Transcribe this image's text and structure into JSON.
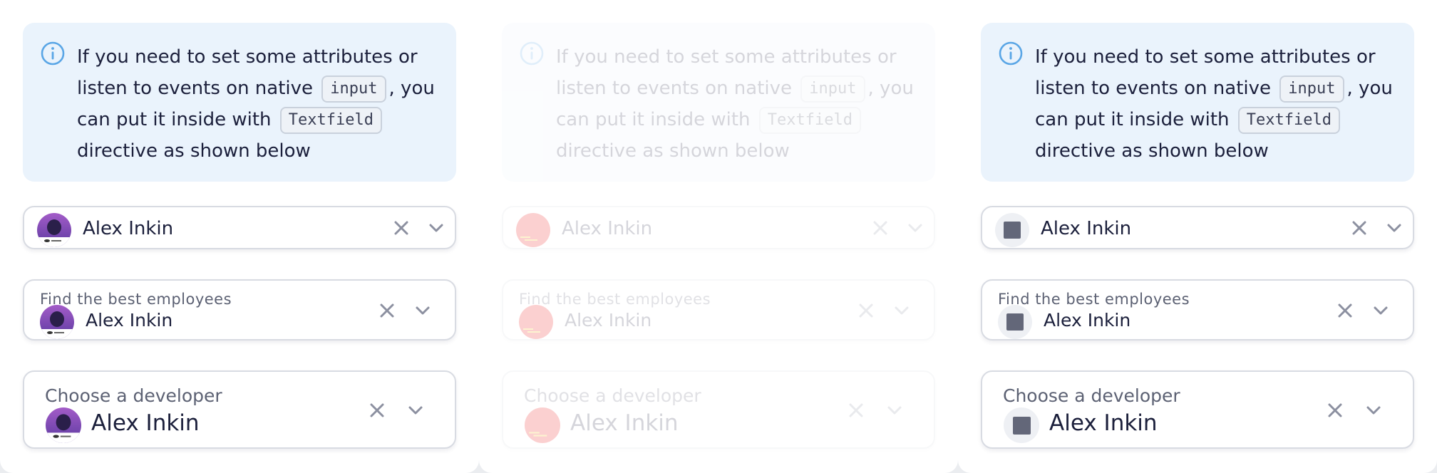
{
  "notice": {
    "text_before_input": "If you need to set some attributes or listen to events on native",
    "input_code": "input",
    "text_middle": ", you can put it inside with",
    "textfield_code": "Textfield",
    "text_after": "directive as shown below"
  },
  "fields": {
    "simple": {
      "value": "Alex Inkin"
    },
    "labeled_small": {
      "label": "Find the best employees",
      "value": "Alex Inkin"
    },
    "labeled_large": {
      "label": "Choose a developer",
      "value": "Alex Inkin"
    }
  },
  "icons": {
    "info": "info-circle-icon",
    "clear": "close-icon",
    "expand": "chevron-down-icon"
  },
  "colors": {
    "notice_background": "#eaf3fc",
    "info_icon": "#5aa6e6",
    "text_primary": "#1b1f3b",
    "text_secondary": "#5c6173",
    "field_border": "#d8dbe2",
    "icon_gray": "#8c90a0",
    "avatar_broken": "#ee0000",
    "avatar_placeholder": "#636779"
  },
  "panels": [
    {
      "state": "default",
      "avatar": "photo"
    },
    {
      "state": "disabled",
      "avatar": "broken-image"
    },
    {
      "state": "default",
      "avatar": "placeholder"
    }
  ]
}
